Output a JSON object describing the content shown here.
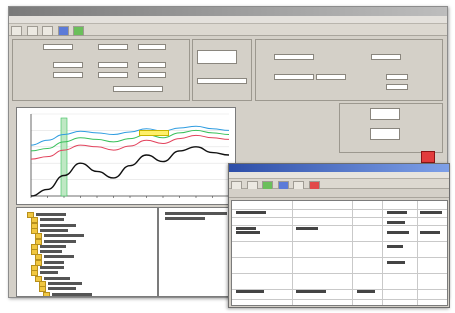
{
  "window": {
    "title": "",
    "menu": [
      "",
      "",
      "",
      ""
    ]
  },
  "left_panel": {
    "fields": [
      "",
      "",
      "",
      "",
      "",
      ""
    ]
  },
  "right_panel": {
    "fields": [
      "",
      "",
      "",
      ""
    ]
  },
  "popup": {
    "title": ""
  },
  "colors": {
    "accent": "#2d4ea8",
    "stop": "#e23c3c",
    "chip": "#fff06a",
    "series": [
      "#2e9ce0",
      "#37c05a",
      "#e2415b",
      "#111111"
    ]
  },
  "chart_data": {
    "type": "line",
    "title": "",
    "x": [
      0,
      1,
      2,
      3,
      4,
      5,
      6,
      7,
      8,
      9,
      10,
      11,
      12
    ],
    "series": [
      {
        "color": "#2e9ce0",
        "values": [
          62,
          68,
          75,
          79,
          77,
          75,
          78,
          82,
          79,
          83,
          85,
          82,
          80
        ]
      },
      {
        "color": "#37c05a",
        "values": [
          55,
          58,
          66,
          71,
          69,
          66,
          70,
          75,
          71,
          77,
          80,
          77,
          75
        ]
      },
      {
        "color": "#e2415b",
        "values": [
          45,
          48,
          56,
          62,
          60,
          56,
          61,
          68,
          64,
          70,
          74,
          71,
          69
        ]
      },
      {
        "color": "#111111",
        "values": [
          0,
          8,
          25,
          40,
          30,
          22,
          37,
          50,
          42,
          55,
          60,
          53,
          50
        ]
      }
    ],
    "ylim": [
      0,
      100
    ],
    "grid": true
  }
}
